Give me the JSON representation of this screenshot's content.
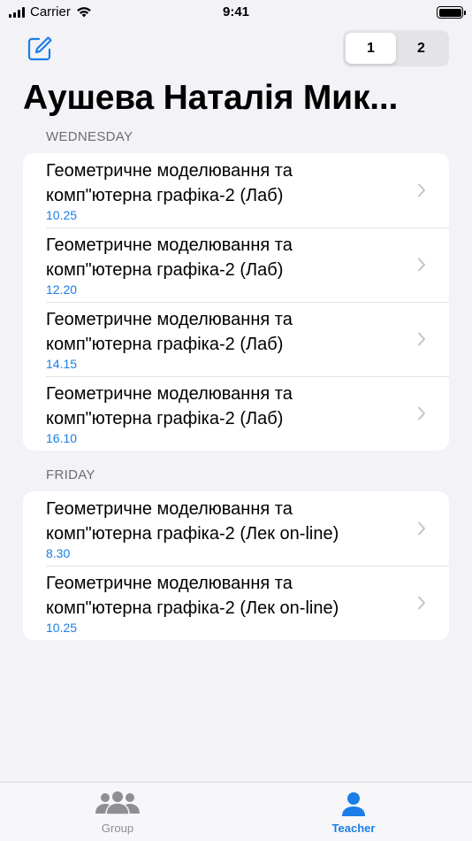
{
  "status_bar": {
    "carrier": "Carrier",
    "time": "9:41"
  },
  "header": {
    "compose_icon": "compose-icon",
    "segments": [
      {
        "label": "1",
        "selected": true
      },
      {
        "label": "2",
        "selected": false
      }
    ],
    "title": "Аушева Наталія Мик..."
  },
  "sections": [
    {
      "header": "WEDNESDAY",
      "items": [
        {
          "title_line1": "Геометричне моделювання та",
          "title_line2": "комп\"ютерна графіка-2 (Лаб)",
          "time": "10.25"
        },
        {
          "title_line1": "Геометричне моделювання та",
          "title_line2": "комп\"ютерна графіка-2 (Лаб)",
          "time": "12.20"
        },
        {
          "title_line1": "Геометричне моделювання та",
          "title_line2": "комп\"ютерна графіка-2 (Лаб)",
          "time": "14.15"
        },
        {
          "title_line1": "Геометричне моделювання та",
          "title_line2": "комп\"ютерна графіка-2 (Лаб)",
          "time": "16.10"
        }
      ]
    },
    {
      "header": "FRIDAY",
      "items": [
        {
          "title_line1": "Геометричне моделювання та",
          "title_line2": "комп\"ютерна графіка-2 (Лек on-line)",
          "time": "8.30"
        },
        {
          "title_line1": "Геометричне моделювання та",
          "title_line2": "комп\"ютерна графіка-2 (Лек on-line)",
          "time": "10.25"
        }
      ]
    }
  ],
  "tab_bar": {
    "tabs": [
      {
        "label": "Group",
        "icon": "group-icon",
        "selected": false
      },
      {
        "label": "Teacher",
        "icon": "person-icon",
        "selected": true
      }
    ]
  },
  "colors": {
    "accent": "#1a7ee8",
    "background": "#f2f2f7",
    "inactive_tab": "#8e8e93"
  }
}
